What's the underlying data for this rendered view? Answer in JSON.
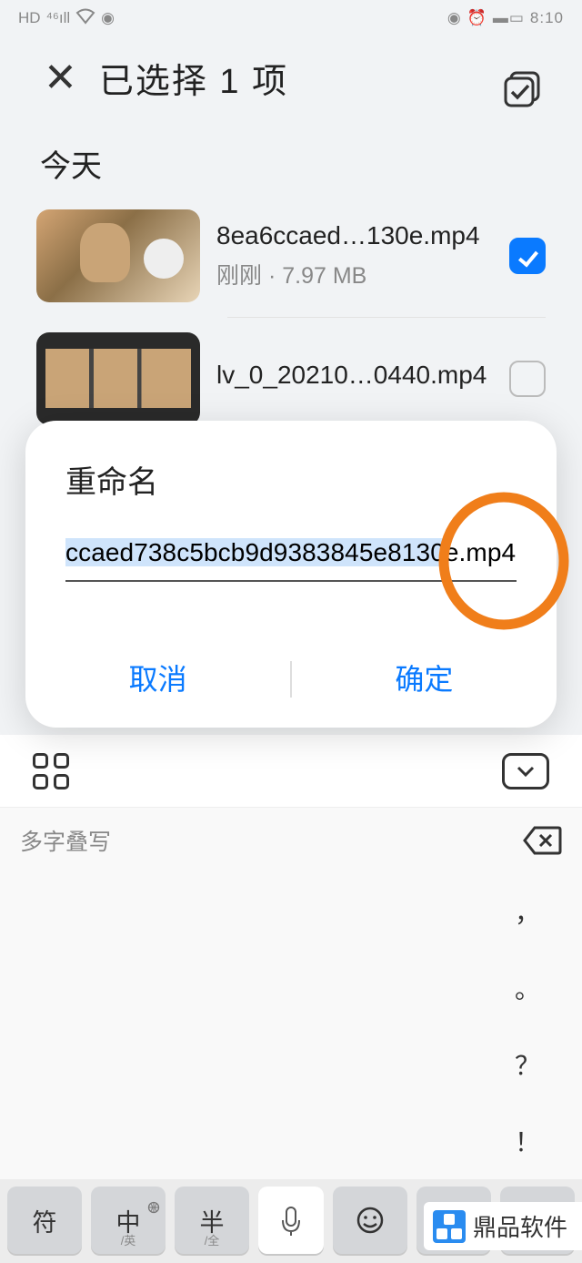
{
  "status": {
    "time": "8:10"
  },
  "header": {
    "title": "已选择 1 项"
  },
  "section": {
    "today": "今天"
  },
  "files": [
    {
      "name": "8ea6ccaed…130e.mp4",
      "meta": "刚刚 · 7.97 MB",
      "checked": true
    },
    {
      "name": "lv_0_20210…0440.mp4",
      "meta": "",
      "checked": false
    }
  ],
  "dialog": {
    "title": "重命名",
    "input_selected": "ccaed738c5bcb9d9383845e8130",
    "input_ext": "e.mp4",
    "cancel": "取消",
    "confirm": "确定"
  },
  "keyboard": {
    "suggestion": "多字叠写",
    "punct": [
      "，",
      "。",
      "？",
      "！"
    ],
    "keys": {
      "sym": "符",
      "zh": "中",
      "zh_sub": "/英",
      "half": "半",
      "half_sub": "/全"
    }
  },
  "watermark": "鼎品软件"
}
